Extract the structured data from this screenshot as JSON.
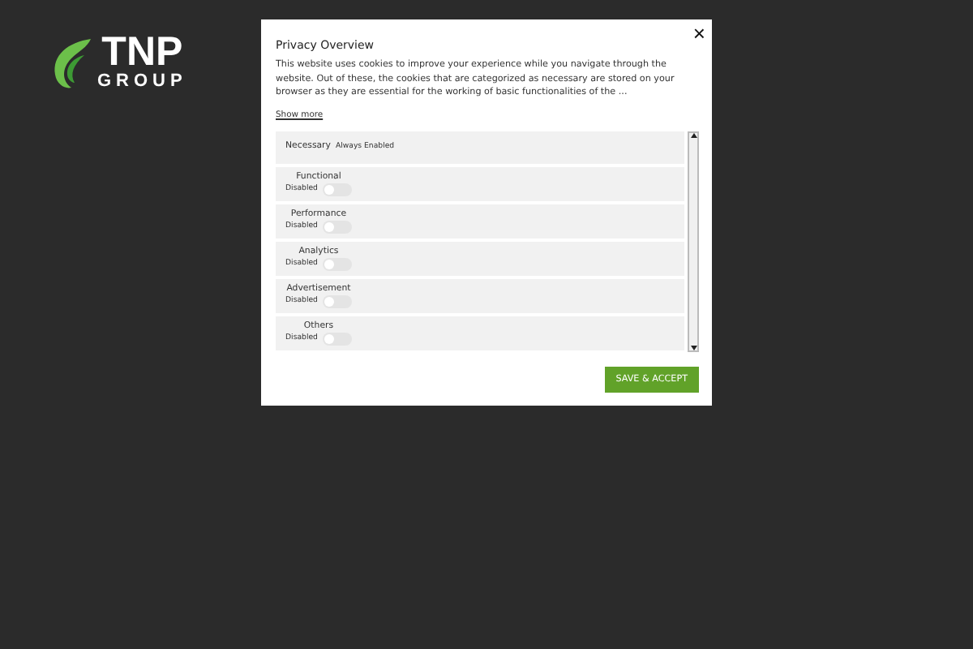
{
  "logo": {
    "name": "TNP",
    "tagline": "GROUP"
  },
  "modal": {
    "close": "×",
    "title": "Privacy Overview",
    "text": "This website uses cookies to improve your experience while you navigate through the website. Out of these, the cookies that are categorized as necessary are stored on your browser as they are essential for the working of basic functionalities of the ...",
    "show_more": "Show more",
    "categories": [
      {
        "kind": "always",
        "name": "Necessary",
        "status": "Always Enabled"
      },
      {
        "kind": "toggle",
        "name": "Functional",
        "status": "Disabled",
        "on": false
      },
      {
        "kind": "toggle",
        "name": "Performance",
        "status": "Disabled",
        "on": false
      },
      {
        "kind": "toggle",
        "name": "Analytics",
        "status": "Disabled",
        "on": false
      },
      {
        "kind": "toggle",
        "name": "Advertisement",
        "status": "Disabled",
        "on": false
      },
      {
        "kind": "toggle",
        "name": "Others",
        "status": "Disabled",
        "on": false
      }
    ],
    "button": "SAVE & ACCEPT"
  }
}
